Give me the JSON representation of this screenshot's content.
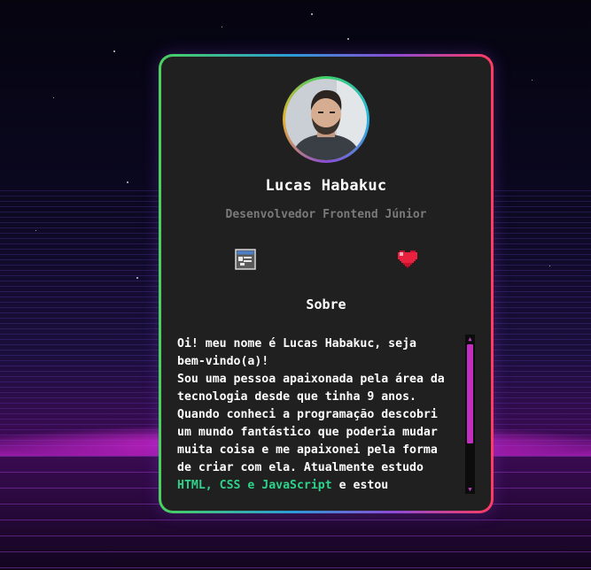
{
  "profile": {
    "name": "Lucas Habakuc",
    "role": "Desenvolvedor Frontend Júnior"
  },
  "icons": {
    "left": "portfolio-window-icon",
    "right": "pixel-heart-icon"
  },
  "about": {
    "title": "Sobre",
    "line1": "Oi! meu nome é Lucas Habakuc, seja bem-vindo(a)!",
    "line2": "Sou uma pessoa apaixonada pela área da tecnologia desde que tinha 9 anos. Quando conheci a programação descobri um mundo fantástico que poderia mudar muita coisa e me apaixonei pela forma de criar com ela. Atualmente estudo",
    "tech": "HTML, CSS e JavaScript",
    "after": "e estou"
  },
  "colors": {
    "card_bg": "#202020",
    "accent_green": "#2ed28a",
    "scroll_thumb": "#c02fc0"
  }
}
